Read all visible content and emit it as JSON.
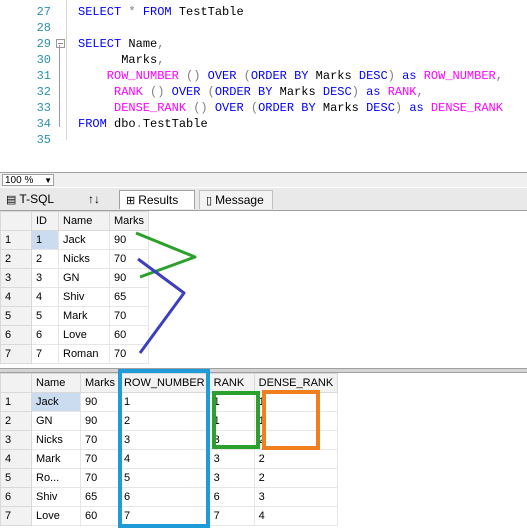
{
  "editor": {
    "lines": [
      {
        "num": "27",
        "segments": [
          {
            "t": "SELECT",
            "c": "kw"
          },
          {
            "t": " ",
            "c": "txt"
          },
          {
            "t": "*",
            "c": "op"
          },
          {
            "t": " ",
            "c": "txt"
          },
          {
            "t": "FROM",
            "c": "kw"
          },
          {
            "t": " TestTable",
            "c": "txt"
          }
        ]
      },
      {
        "num": "28",
        "segments": []
      },
      {
        "num": "29",
        "segments": [
          {
            "t": "SELECT",
            "c": "kw"
          },
          {
            "t": " Name",
            "c": "txt"
          },
          {
            "t": ",",
            "c": "op"
          }
        ]
      },
      {
        "num": "30",
        "segments": [
          {
            "t": "      Marks",
            "c": "txt"
          },
          {
            "t": ",",
            "c": "op"
          }
        ]
      },
      {
        "num": "31",
        "segments": [
          {
            "t": "    ROW_NUMBER",
            "c": "fn"
          },
          {
            "t": " () ",
            "c": "op"
          },
          {
            "t": "OVER",
            "c": "kw"
          },
          {
            "t": " (",
            "c": "op"
          },
          {
            "t": "ORDER BY",
            "c": "kw"
          },
          {
            "t": " Marks ",
            "c": "txt"
          },
          {
            "t": "DESC",
            "c": "kw"
          },
          {
            "t": ") ",
            "c": "op"
          },
          {
            "t": "as",
            "c": "kw"
          },
          {
            "t": " ROW_NUMBER",
            "c": "fn"
          },
          {
            "t": ",",
            "c": "op"
          }
        ]
      },
      {
        "num": "32",
        "segments": [
          {
            "t": "     RANK",
            "c": "fn"
          },
          {
            "t": " () ",
            "c": "op"
          },
          {
            "t": "OVER",
            "c": "kw"
          },
          {
            "t": " (",
            "c": "op"
          },
          {
            "t": "ORDER BY",
            "c": "kw"
          },
          {
            "t": " Marks ",
            "c": "txt"
          },
          {
            "t": "DESC",
            "c": "kw"
          },
          {
            "t": ") ",
            "c": "op"
          },
          {
            "t": "as",
            "c": "kw"
          },
          {
            "t": " RANK",
            "c": "fn"
          },
          {
            "t": ",",
            "c": "op"
          }
        ]
      },
      {
        "num": "33",
        "segments": [
          {
            "t": "     DENSE_RANK",
            "c": "fn"
          },
          {
            "t": " () ",
            "c": "op"
          },
          {
            "t": "OVER",
            "c": "kw"
          },
          {
            "t": " (",
            "c": "op"
          },
          {
            "t": "ORDER BY",
            "c": "kw"
          },
          {
            "t": " Marks ",
            "c": "txt"
          },
          {
            "t": "DESC",
            "c": "kw"
          },
          {
            "t": ") ",
            "c": "op"
          },
          {
            "t": "as",
            "c": "kw"
          },
          {
            "t": " DENSE_RANK",
            "c": "fn"
          }
        ]
      },
      {
        "num": "34",
        "segments": [
          {
            "t": "FROM",
            "c": "kw"
          },
          {
            "t": " dbo",
            "c": "txt"
          },
          {
            "t": ".",
            "c": "op"
          },
          {
            "t": "TestTable",
            "c": "txt"
          }
        ]
      },
      {
        "num": "35",
        "segments": []
      }
    ]
  },
  "status": {
    "zoom": "100 %"
  },
  "tabs": {
    "tsql": "T-SQL",
    "arrows": "↑↓",
    "results": "Results",
    "messages": "Message"
  },
  "grid1": {
    "headers": [
      "ID",
      "Name",
      "Marks"
    ],
    "rows": [
      {
        "n": "1",
        "cells": [
          "1",
          "Jack",
          "90"
        ]
      },
      {
        "n": "2",
        "cells": [
          "2",
          "Nicks",
          "70"
        ]
      },
      {
        "n": "3",
        "cells": [
          "3",
          "GN",
          "90"
        ]
      },
      {
        "n": "4",
        "cells": [
          "4",
          "Shiv",
          "65"
        ]
      },
      {
        "n": "5",
        "cells": [
          "5",
          "Mark",
          "70"
        ]
      },
      {
        "n": "6",
        "cells": [
          "6",
          "Love",
          "60"
        ]
      },
      {
        "n": "7",
        "cells": [
          "7",
          "Roman",
          "70"
        ]
      }
    ]
  },
  "grid2": {
    "headers": [
      "Name",
      "Marks",
      "ROW_NUMBER",
      "RANK",
      "DENSE_RANK"
    ],
    "rows": [
      {
        "n": "1",
        "cells": [
          "Jack",
          "90",
          "1",
          "1",
          "1"
        ]
      },
      {
        "n": "2",
        "cells": [
          "GN",
          "90",
          "2",
          "1",
          "1"
        ]
      },
      {
        "n": "3",
        "cells": [
          "Nicks",
          "70",
          "3",
          "3",
          "2"
        ]
      },
      {
        "n": "4",
        "cells": [
          "Mark",
          "70",
          "4",
          "3",
          "2"
        ]
      },
      {
        "n": "5",
        "cells": [
          "Ro...",
          "70",
          "5",
          "3",
          "2"
        ]
      },
      {
        "n": "6",
        "cells": [
          "Shiv",
          "65",
          "6",
          "6",
          "3"
        ]
      },
      {
        "n": "7",
        "cells": [
          "Love",
          "60",
          "7",
          "7",
          "4"
        ]
      }
    ]
  },
  "colors": {
    "keyword": "#0000ff",
    "function": "#ff00ff",
    "annotation_green": "#2ca02c",
    "annotation_blue": "#3b3fc0",
    "annotation_cyan": "#1f9bd7",
    "annotation_orange": "#f07f1e"
  }
}
